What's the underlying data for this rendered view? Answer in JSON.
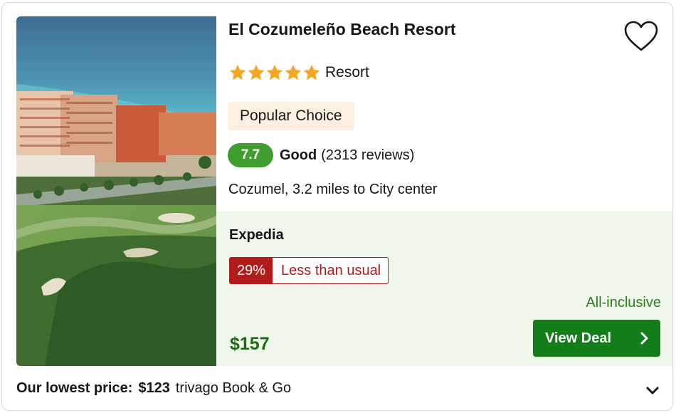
{
  "hotel": {
    "name": "El Cozumeleño Beach Resort",
    "stars": 5,
    "type": "Resort",
    "tag": "Popular Choice",
    "rating": {
      "score": "7.7",
      "label": "Good",
      "reviews": "(2313 reviews)"
    },
    "location": "Cozumel, 3.2 miles to City center"
  },
  "deal": {
    "provider": "Expedia",
    "discount_percent": "29%",
    "discount_label": "Less than usual",
    "board": "All-inclusive",
    "price": "$157",
    "cta_label": "View Deal"
  },
  "footer": {
    "label": "Our lowest price:",
    "price": "$123",
    "provider": "trivago Book & Go"
  },
  "colors": {
    "star": "#f5a623",
    "score_badge": "#3f9e2e",
    "deal_bg": "#eff6ea",
    "discount_red": "#b21b1b",
    "price_green": "#1e6a17",
    "cta_green": "#137d1a",
    "popular_bg": "#fdf0e3"
  },
  "icons": {
    "favorite": "heart-outline-icon",
    "cta": "chevron-right-icon",
    "expand": "chevron-down-icon",
    "rating": "star-icon"
  }
}
